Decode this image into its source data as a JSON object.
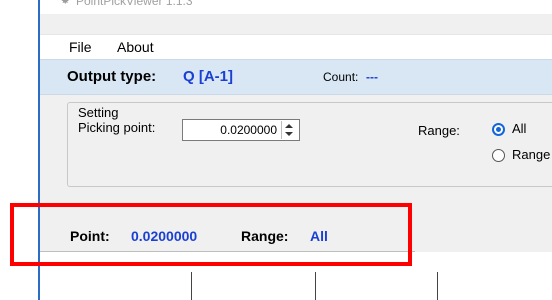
{
  "window": {
    "title": "PointPickViewer 1.1.3",
    "app_icon": "app-icon"
  },
  "menu": {
    "items": [
      "File",
      "About"
    ]
  },
  "output": {
    "type_label": "Output type:",
    "type_value": "Q [A-1]",
    "count_label": "Count:",
    "count_value": "---"
  },
  "setting": {
    "legend": "Setting",
    "picking_label": "Picking point:",
    "picking_value": "0.0200000",
    "range_label": "Range:",
    "range_options": [
      "All",
      "Range"
    ],
    "range_selected": "All"
  },
  "status": {
    "point_label": "Point:",
    "point_value": "0.0200000",
    "range_label": "Range:",
    "range_value": "All"
  },
  "colors": {
    "accent": "#1a3fd4",
    "output_bar": "#d9e7f5",
    "window_border": "#2b6cc4",
    "highlight": "#ff0000"
  }
}
